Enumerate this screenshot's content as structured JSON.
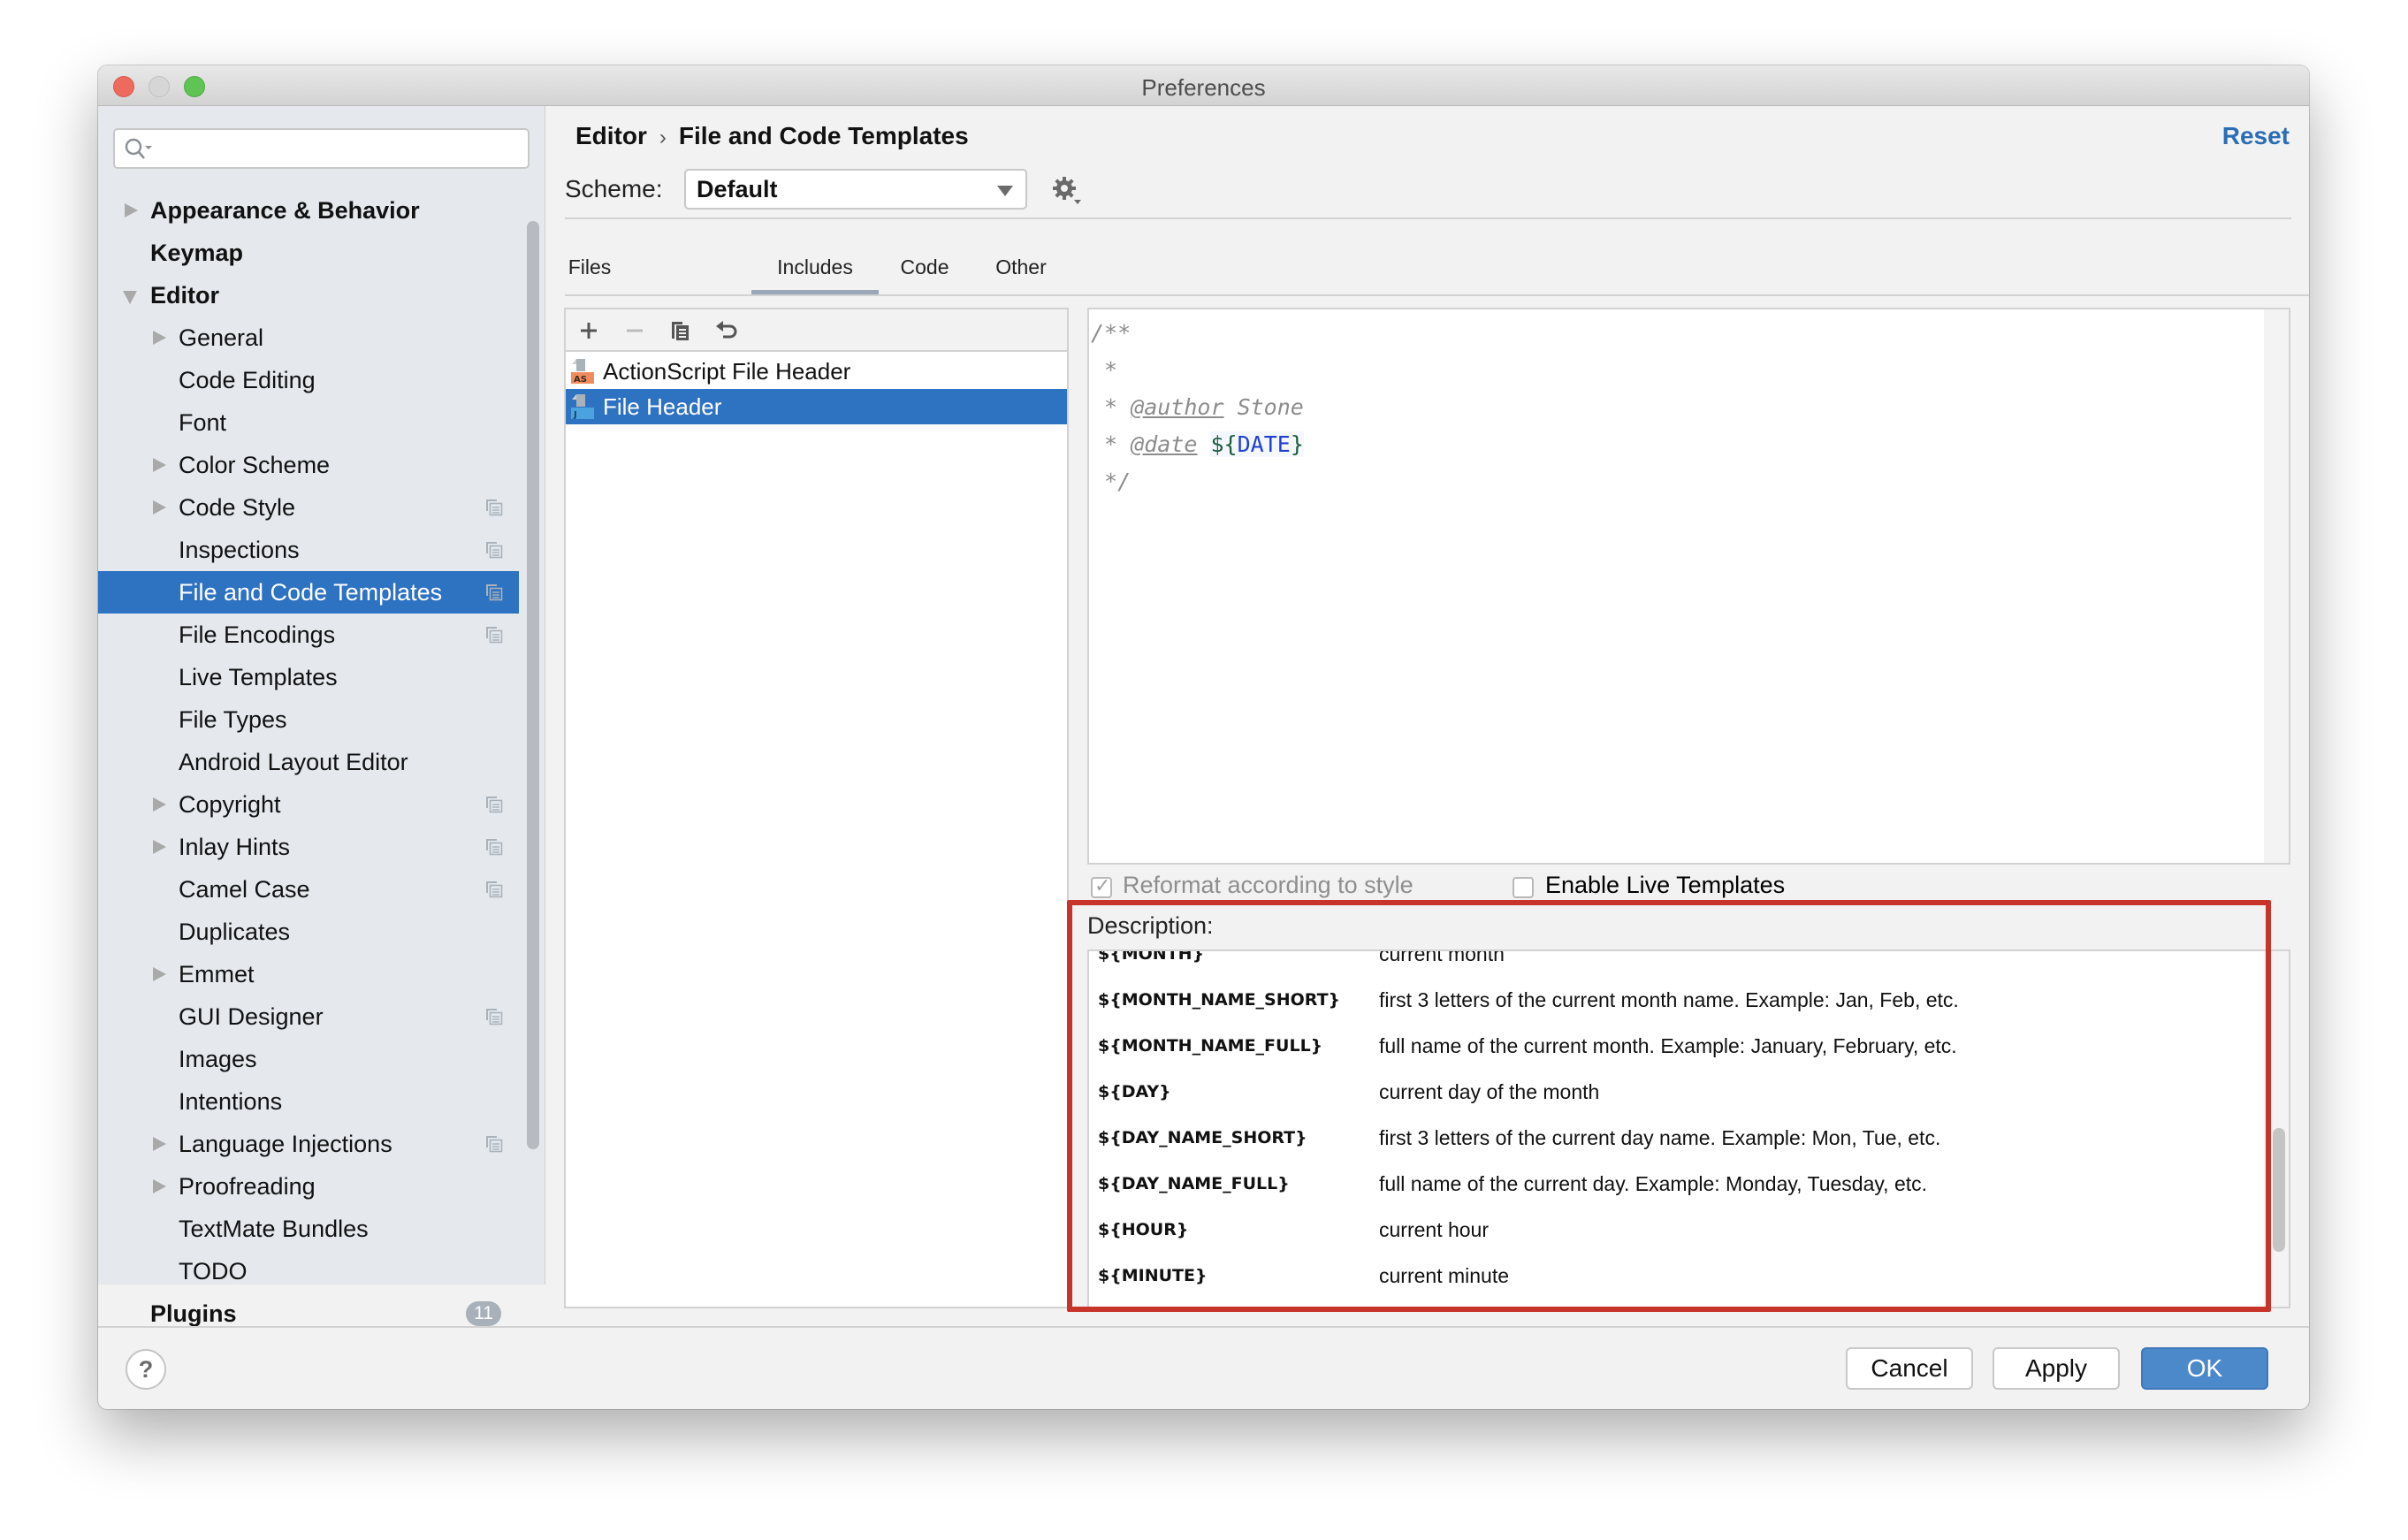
{
  "window": {
    "title": "Preferences"
  },
  "sidebar": {
    "search_placeholder": "",
    "items": [
      {
        "label": "Appearance & Behavior",
        "level": 0,
        "arrow": "right",
        "copy": false
      },
      {
        "label": "Keymap",
        "level": 0,
        "arrow": "none",
        "copy": false
      },
      {
        "label": "Editor",
        "level": 0,
        "arrow": "down",
        "copy": false
      },
      {
        "label": "General",
        "level": 1,
        "arrow": "right",
        "copy": false
      },
      {
        "label": "Code Editing",
        "level": 1,
        "arrow": "none",
        "copy": false
      },
      {
        "label": "Font",
        "level": 1,
        "arrow": "none",
        "copy": false
      },
      {
        "label": "Color Scheme",
        "level": 1,
        "arrow": "right",
        "copy": false
      },
      {
        "label": "Code Style",
        "level": 1,
        "arrow": "right",
        "copy": true
      },
      {
        "label": "Inspections",
        "level": 1,
        "arrow": "none",
        "copy": true
      },
      {
        "label": "File and Code Templates",
        "level": 1,
        "arrow": "none",
        "copy": true,
        "selected": true
      },
      {
        "label": "File Encodings",
        "level": 1,
        "arrow": "none",
        "copy": true
      },
      {
        "label": "Live Templates",
        "level": 1,
        "arrow": "none",
        "copy": false
      },
      {
        "label": "File Types",
        "level": 1,
        "arrow": "none",
        "copy": false
      },
      {
        "label": "Android Layout Editor",
        "level": 1,
        "arrow": "none",
        "copy": false
      },
      {
        "label": "Copyright",
        "level": 1,
        "arrow": "right",
        "copy": true
      },
      {
        "label": "Inlay Hints",
        "level": 1,
        "arrow": "right",
        "copy": true
      },
      {
        "label": "Camel Case",
        "level": 1,
        "arrow": "none",
        "copy": true
      },
      {
        "label": "Duplicates",
        "level": 1,
        "arrow": "none",
        "copy": false
      },
      {
        "label": "Emmet",
        "level": 1,
        "arrow": "right",
        "copy": false
      },
      {
        "label": "GUI Designer",
        "level": 1,
        "arrow": "none",
        "copy": true
      },
      {
        "label": "Images",
        "level": 1,
        "arrow": "none",
        "copy": false
      },
      {
        "label": "Intentions",
        "level": 1,
        "arrow": "none",
        "copy": false
      },
      {
        "label": "Language Injections",
        "level": 1,
        "arrow": "right",
        "copy": true
      },
      {
        "label": "Proofreading",
        "level": 1,
        "arrow": "right",
        "copy": false
      },
      {
        "label": "TextMate Bundles",
        "level": 1,
        "arrow": "none",
        "copy": false
      },
      {
        "label": "TODO",
        "level": 1,
        "arrow": "none",
        "copy": false
      },
      {
        "label": "Plugins",
        "level": 0,
        "arrow": "none",
        "copy": false,
        "badge": "11"
      }
    ]
  },
  "header": {
    "breadcrumb": [
      "Editor",
      "File and Code Templates"
    ],
    "breadcrumb_separator": "›",
    "reset_label": "Reset"
  },
  "scheme": {
    "label": "Scheme:",
    "value": "Default"
  },
  "tabs": [
    {
      "label": "Files",
      "active": false
    },
    {
      "label": "Includes",
      "active": true
    },
    {
      "label": "Code",
      "active": false
    },
    {
      "label": "Other",
      "active": false
    }
  ],
  "template_list": {
    "toolbar": [
      "add-icon",
      "remove-icon",
      "copy-icon",
      "reset-icon"
    ],
    "items": [
      {
        "label": "ActionScript File Header",
        "icon": "AS",
        "icon_color": "#f08b5e",
        "selected": false
      },
      {
        "label": "File Header",
        "icon": "J",
        "icon_color": "#4aa3df",
        "selected": true
      }
    ]
  },
  "editor": {
    "lines": [
      {
        "parts": [
          {
            "t": "/**",
            "k": "comment"
          }
        ]
      },
      {
        "parts": [
          {
            "t": " *",
            "k": "comment"
          }
        ]
      },
      {
        "parts": [
          {
            "t": " * ",
            "k": "comment"
          },
          {
            "t": "@author",
            "k": "tag"
          },
          {
            "t": " Stone",
            "k": "comment"
          }
        ]
      },
      {
        "parts": [
          {
            "t": " * ",
            "k": "comment"
          },
          {
            "t": "@date",
            "k": "tag"
          },
          {
            "t": " ",
            "k": "comment"
          },
          {
            "t": "DATE",
            "k": "var"
          }
        ]
      },
      {
        "parts": [
          {
            "t": " */",
            "k": "comment"
          }
        ]
      }
    ]
  },
  "options": {
    "reformat": {
      "label": "Reformat according to style",
      "checked": true,
      "disabled": true
    },
    "live_templates": {
      "label": "Enable Live Templates",
      "checked": false
    }
  },
  "description": {
    "label": "Description:",
    "rows": [
      {
        "var": "${MONTH}",
        "text": "current month"
      },
      {
        "var": "${MONTH_NAME_SHORT}",
        "text": "first 3 letters of the current month name. Example: Jan, Feb, etc."
      },
      {
        "var": "${MONTH_NAME_FULL}",
        "text": "full name of the current month. Example: January, February, etc."
      },
      {
        "var": "${DAY}",
        "text": "current day of the month"
      },
      {
        "var": "${DAY_NAME_SHORT}",
        "text": "first 3 letters of the current day name. Example: Mon, Tue, etc."
      },
      {
        "var": "${DAY_NAME_FULL}",
        "text": "full name of the current day. Example: Monday, Tuesday, etc."
      },
      {
        "var": "${HOUR}",
        "text": "current hour"
      },
      {
        "var": "${MINUTE}",
        "text": "current minute"
      }
    ]
  },
  "footer": {
    "help_label": "?",
    "cancel_label": "Cancel",
    "apply_label": "Apply",
    "ok_label": "OK"
  },
  "colors": {
    "selection": "#2e72c2",
    "link": "#2b6db5",
    "highlight_box": "#c9342a",
    "primary_button": "#4c89cb"
  }
}
